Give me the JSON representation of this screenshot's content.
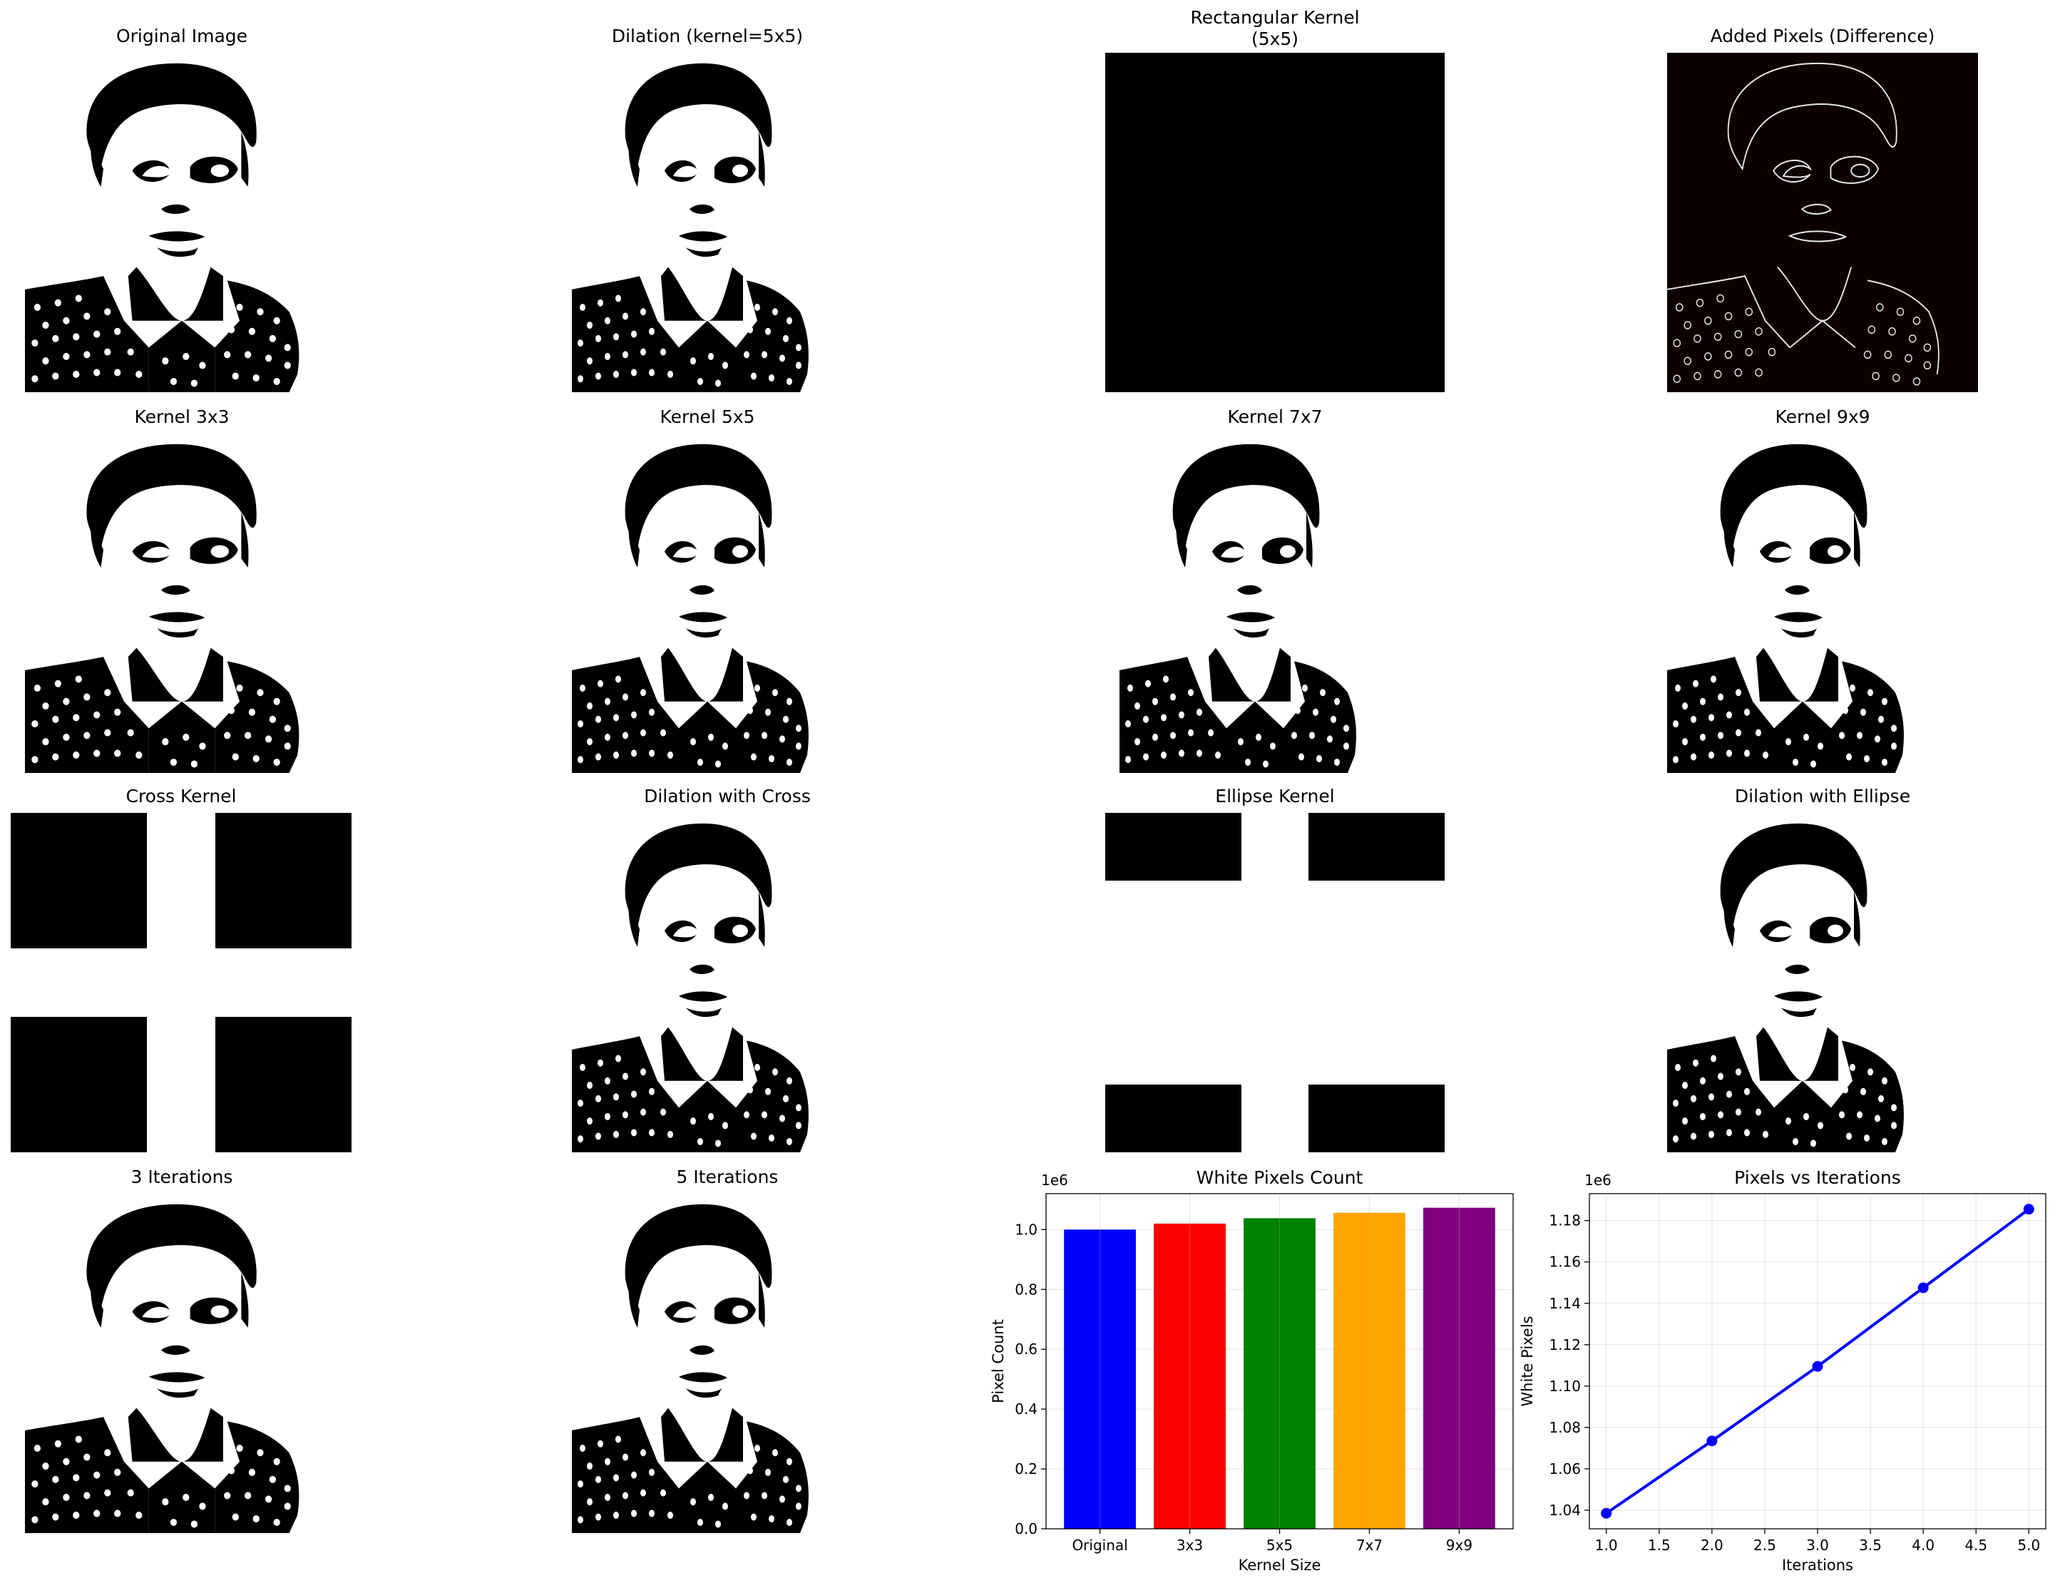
{
  "titles": {
    "original": "Original Image",
    "dilation": "Dilation (kernel=5x5)",
    "rect_kernel": "Rectangular Kernel\n(5x5)",
    "added": "Added Pixels (Difference)",
    "k3": "Kernel 3x3",
    "k5": "Kernel 5x5",
    "k7": "Kernel 7x7",
    "k9": "Kernel 9x9",
    "cross_kernel": "Cross Kernel",
    "dil_cross": "Dilation with Cross",
    "ellipse_kernel": "Ellipse Kernel",
    "dil_ellipse": "Dilation with Ellipse",
    "it3": "3 Iterations",
    "it5": "5 Iterations"
  },
  "chart_data": [
    {
      "type": "bar",
      "title": "White Pixels Count",
      "xlabel": "Kernel Size",
      "ylabel": "Pixel Count",
      "offset_label": "1e6",
      "categories": [
        "Original",
        "3x3",
        "5x5",
        "7x7",
        "9x9"
      ],
      "values": [
        1.0,
        1.02,
        1.038,
        1.056,
        1.073
      ],
      "colors": [
        "#0000ff",
        "#ff0000",
        "#008000",
        "#ffa500",
        "#800080"
      ],
      "ylim": [
        0,
        1.12
      ],
      "yticks": [
        "0.0",
        "0.2",
        "0.4",
        "0.6",
        "0.8",
        "1.0"
      ],
      "grid": true
    },
    {
      "type": "line",
      "title": "Pixels vs Iterations",
      "xlabel": "Iterations",
      "ylabel": "White Pixels",
      "offset_label": "1e6",
      "x": [
        1,
        2,
        3,
        4,
        5
      ],
      "y": [
        1.0385,
        1.0735,
        1.1095,
        1.1475,
        1.1855
      ],
      "color": "#0000ff",
      "xlim": [
        0.84,
        5.16
      ],
      "ylim": [
        1.031,
        1.193
      ],
      "xticks": [
        "1.0",
        "1.5",
        "2.0",
        "2.5",
        "3.0",
        "3.5",
        "4.0",
        "4.5",
        "5.0"
      ],
      "yticks": [
        "1.04",
        "1.06",
        "1.08",
        "1.10",
        "1.12",
        "1.14",
        "1.16",
        "1.18"
      ],
      "grid": true
    }
  ]
}
